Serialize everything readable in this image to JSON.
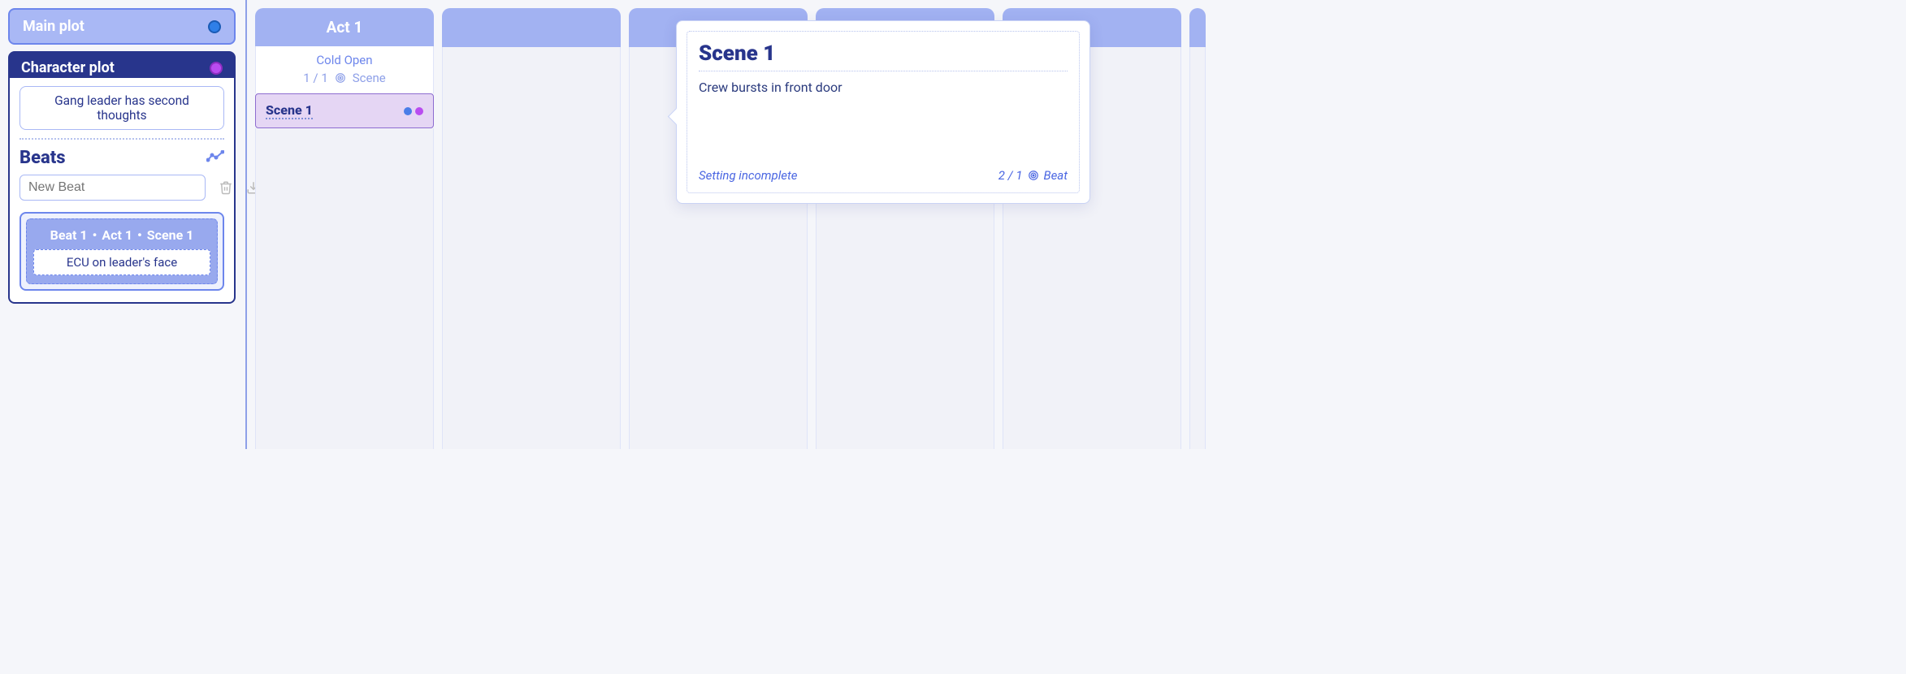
{
  "sidebar": {
    "main_plot_label": "Main plot",
    "character_plot_label": "Character plot",
    "character_desc": "Gang leader has second thoughts",
    "beats_title": "Beats",
    "new_beat_placeholder": "New Beat",
    "beat_card": {
      "beat": "Beat 1",
      "act": "Act 1",
      "scene": "Scene 1",
      "desc": "ECU on leader's face"
    }
  },
  "board": {
    "act1": {
      "title": "Act 1",
      "subtitle": "Cold Open",
      "count": "1 / 1",
      "unit": "Scene",
      "scene": {
        "name": "Scene 1"
      }
    }
  },
  "popover": {
    "title": "Scene 1",
    "body": "Crew bursts in front door",
    "setting_status": "Setting incomplete",
    "count": "2 / 1",
    "unit": "Beat"
  }
}
